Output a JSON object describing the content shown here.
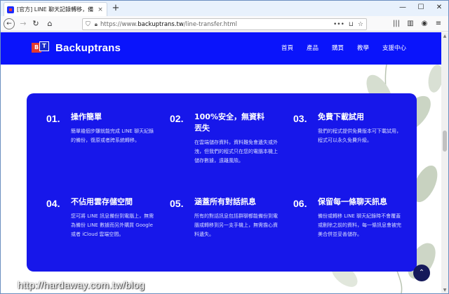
{
  "browser": {
    "tab_title": "[官方] LINE 聊天記錄轉移，備",
    "tab_close": "×",
    "new_tab": "+",
    "win_min": "—",
    "win_max": "☐",
    "win_close": "✕",
    "url_prefix": "https://www.",
    "url_domain": "backuptrans.tw",
    "url_path": "/line-transfer.html",
    "url_more": "•••"
  },
  "site": {
    "brand": "Backuptrans",
    "logo_b": "B",
    "logo_t": "T",
    "menu": [
      "首頁",
      "產品",
      "購買",
      "教學",
      "支援中心"
    ]
  },
  "features": [
    {
      "num": "01.",
      "title": "操作簡單",
      "desc": "簡單幾個步驟就能完成 LINE 聊天紀錄的備份，復原或者跨系統轉移。"
    },
    {
      "num": "02.",
      "title": "100%安全，無資料丟失",
      "desc": "在雲端儲存資料，資料難免會遺失或外洩，但我們的程式只在您的電腦本機上儲存數據，遠離風險。"
    },
    {
      "num": "03.",
      "title": "免費下載試用",
      "desc": "我們的程式提供免費版本可下載試用，程式可以永久免費升級。"
    },
    {
      "num": "04.",
      "title": "不佔用雲存儲空間",
      "desc": "您可將 LINE 訊息備份到電腦上，無需為備份 LINE 數據而另外購買 Google 或者 iCloud 雲端空間。"
    },
    {
      "num": "05.",
      "title": "涵蓋所有對話訊息",
      "desc": "所有的對話訊息包括群聊都能備份到電腦或轉移到另一支手機上，無需擔心資料遺失。"
    },
    {
      "num": "06.",
      "title": "保留每一條聊天訊息",
      "desc": "備份或轉移 LINE 聊天紀錄時不會覆蓋或刪除之前的資料，每一條訊息會被完美合併並妥善儲存。"
    }
  ],
  "scroll_top_label": "⌃",
  "watermark": "http://hardaway.com.tw/blog"
}
